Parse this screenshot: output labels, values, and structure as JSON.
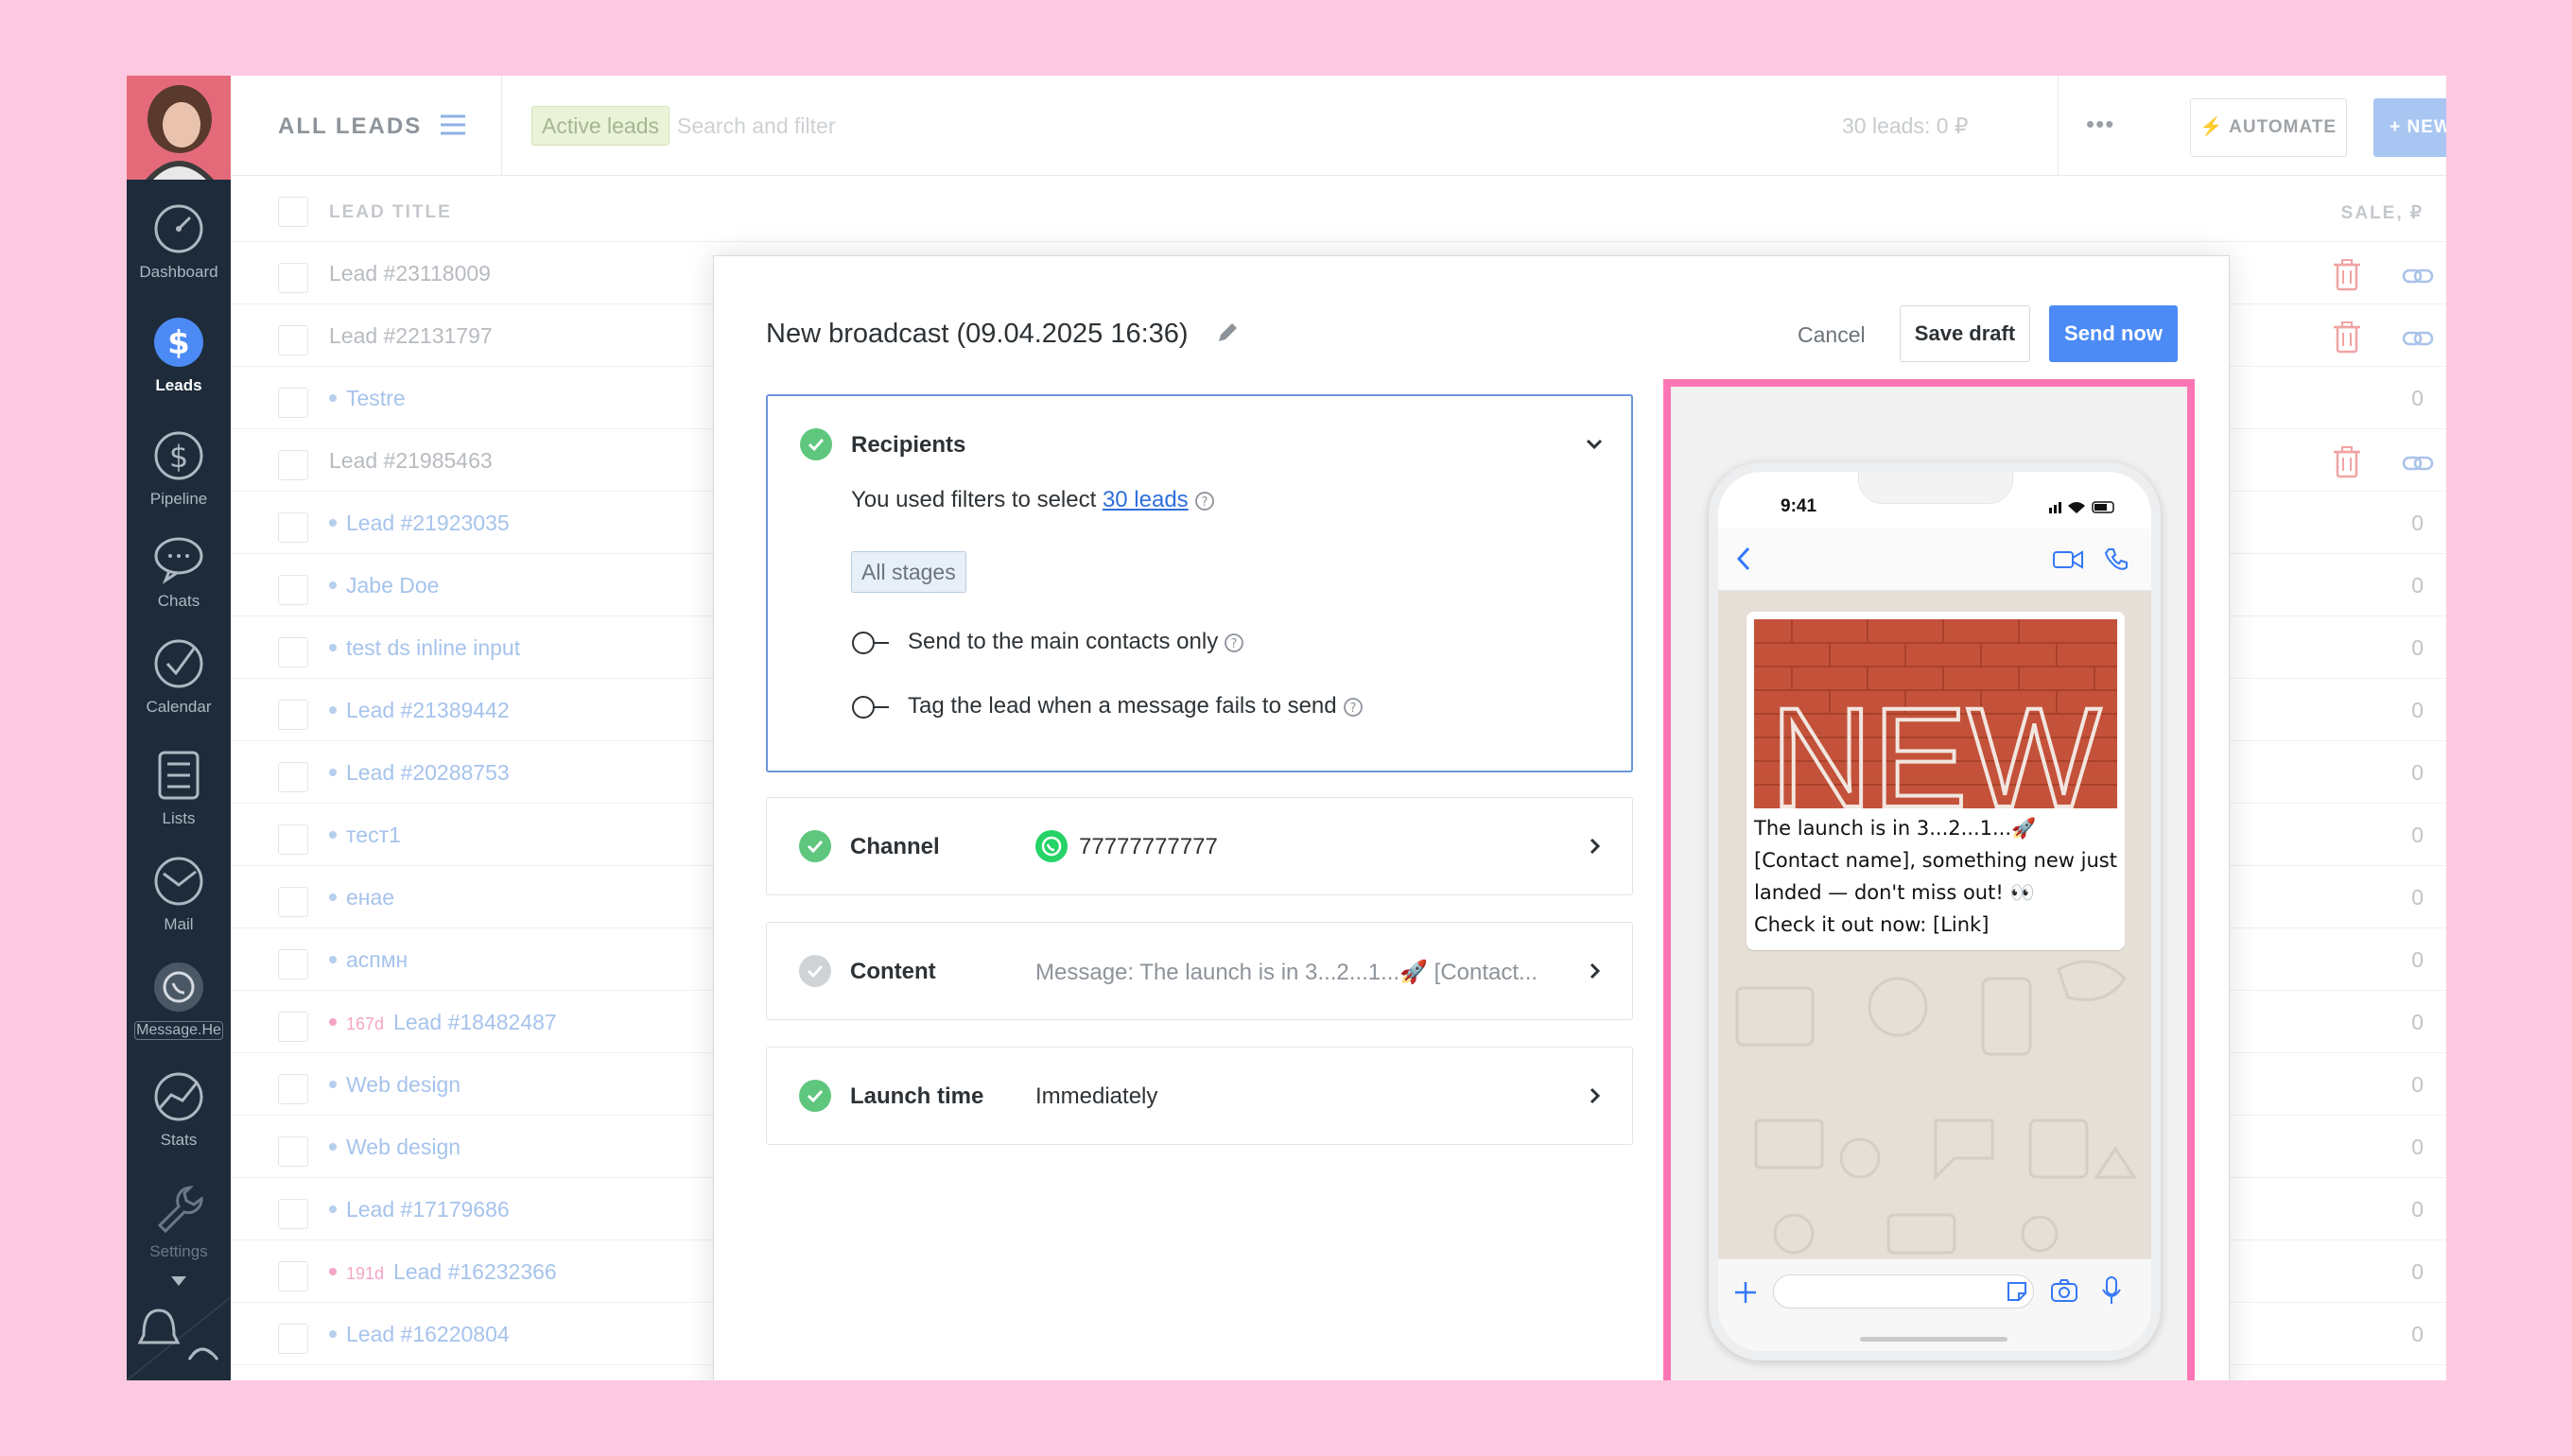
{
  "sidebar": {
    "items": [
      {
        "label": "Dashboard"
      },
      {
        "label": "Leads"
      },
      {
        "label": "Pipeline"
      },
      {
        "label": "Chats"
      },
      {
        "label": "Calendar"
      },
      {
        "label": "Lists"
      },
      {
        "label": "Mail"
      },
      {
        "label": "Message.He"
      },
      {
        "label": "Stats"
      },
      {
        "label": "Settings"
      }
    ]
  },
  "topbar": {
    "title": "ALL LEADS",
    "filter_chip": "Active leads",
    "search_placeholder": "Search and filter",
    "summary": "30 leads: 0 ₽",
    "more": "•••",
    "automate": "AUTOMATE",
    "new_lead": "+ NEW LEAD"
  },
  "table": {
    "header_title": "LEAD TITLE",
    "header_sale": "SALE, ₽",
    "rows": [
      {
        "title": "Lead #23118009",
        "days": "",
        "sale": "",
        "actions": true
      },
      {
        "title": "Lead #22131797",
        "days": "",
        "sale": "",
        "actions": true
      },
      {
        "title": "Testre",
        "days": "",
        "sale": "0",
        "actions": false
      },
      {
        "title": "Lead #21985463",
        "days": "",
        "sale": "",
        "actions": true
      },
      {
        "title": "Lead #21923035",
        "days": "",
        "sale": "0",
        "actions": false
      },
      {
        "title": "Jabe Doe",
        "days": "",
        "sale": "0",
        "actions": false
      },
      {
        "title": "test ds inline input",
        "days": "",
        "sale": "0",
        "actions": false
      },
      {
        "title": "Lead #21389442",
        "days": "",
        "sale": "0",
        "actions": false
      },
      {
        "title": "Lead #20288753",
        "days": "",
        "sale": "0",
        "actions": false
      },
      {
        "title": "тест1",
        "days": "",
        "sale": "0",
        "actions": false
      },
      {
        "title": "енае",
        "days": "",
        "sale": "0",
        "actions": false
      },
      {
        "title": "аспмн",
        "days": "",
        "sale": "0",
        "actions": false
      },
      {
        "title": "Lead #18482487",
        "days": "167d",
        "sale": "0",
        "actions": false
      },
      {
        "title": "Web design",
        "days": "",
        "sale": "0",
        "actions": false
      },
      {
        "title": "Web design",
        "days": "",
        "sale": "0",
        "actions": false
      },
      {
        "title": "Lead #17179686",
        "days": "",
        "sale": "0",
        "actions": false
      },
      {
        "title": "Lead #16232366",
        "days": "191d",
        "sale": "0",
        "actions": false
      },
      {
        "title": "Lead #16220804",
        "days": "",
        "sale": "0",
        "actions": false
      }
    ]
  },
  "modal": {
    "title": "New broadcast (09.04.2025 16:36)",
    "cancel": "Cancel",
    "save_draft": "Save draft",
    "send_now": "Send now",
    "recipients": {
      "title": "Recipients",
      "text_prefix": "You used filters to select ",
      "link": "30 leads",
      "stage_chip": "All stages",
      "toggle_1": "Send to the main contacts only",
      "toggle_2": "Tag the lead when a message fails to send"
    },
    "channel": {
      "title": "Channel",
      "value": "77777777777"
    },
    "content": {
      "title": "Content",
      "value": "Message: The launch is in 3...2...1...🚀 [Contact..."
    },
    "launch": {
      "title": "Launch time",
      "value": "Immediately"
    }
  },
  "preview": {
    "time": "9:41",
    "image_text": "NEW",
    "message": "The launch is in 3...2...1...🚀\n[Contact name], something new just landed — don't miss out! 👀\nCheck it out now: [Link]"
  },
  "colors": {
    "sidebar_bg": "#1d2b3a",
    "accent_blue": "#4c8bf5",
    "highlight_pink": "#fd76b4",
    "success_green": "#5fc67e",
    "whatsapp_green": "#25d366"
  }
}
